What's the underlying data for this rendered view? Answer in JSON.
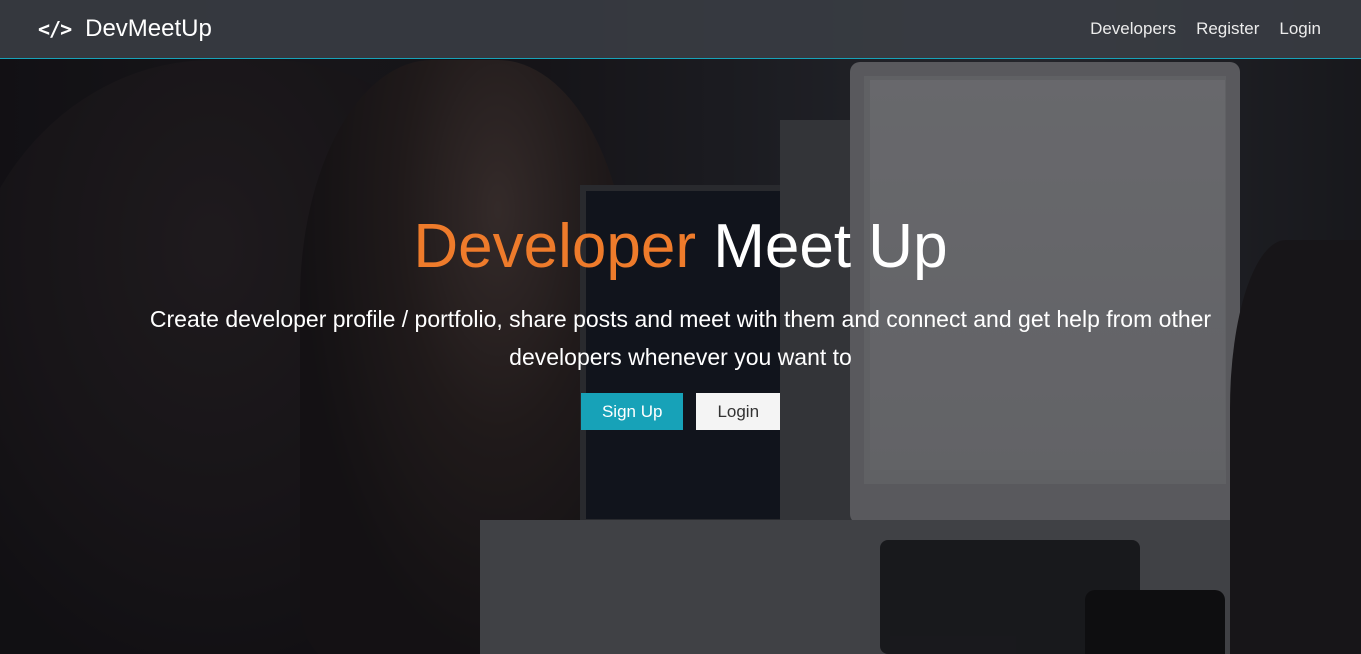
{
  "navbar": {
    "brand_icon": "</>",
    "brand_name": "DevMeetUp",
    "links": [
      "Developers",
      "Register",
      "Login"
    ]
  },
  "hero": {
    "title_accent": "Developer",
    "title_rest": "Meet Up",
    "lead": "Create developer profile / portfolio, share posts and meet with them and connect and get help from other developers whenever you want to",
    "signup_label": "Sign Up",
    "login_label": "Login"
  },
  "colors": {
    "accent_orange": "#ee7b2b",
    "primary_teal": "#17a2b8",
    "navbar_bg": "#3a3d44"
  },
  "icons": {
    "brand": "code-icon"
  }
}
